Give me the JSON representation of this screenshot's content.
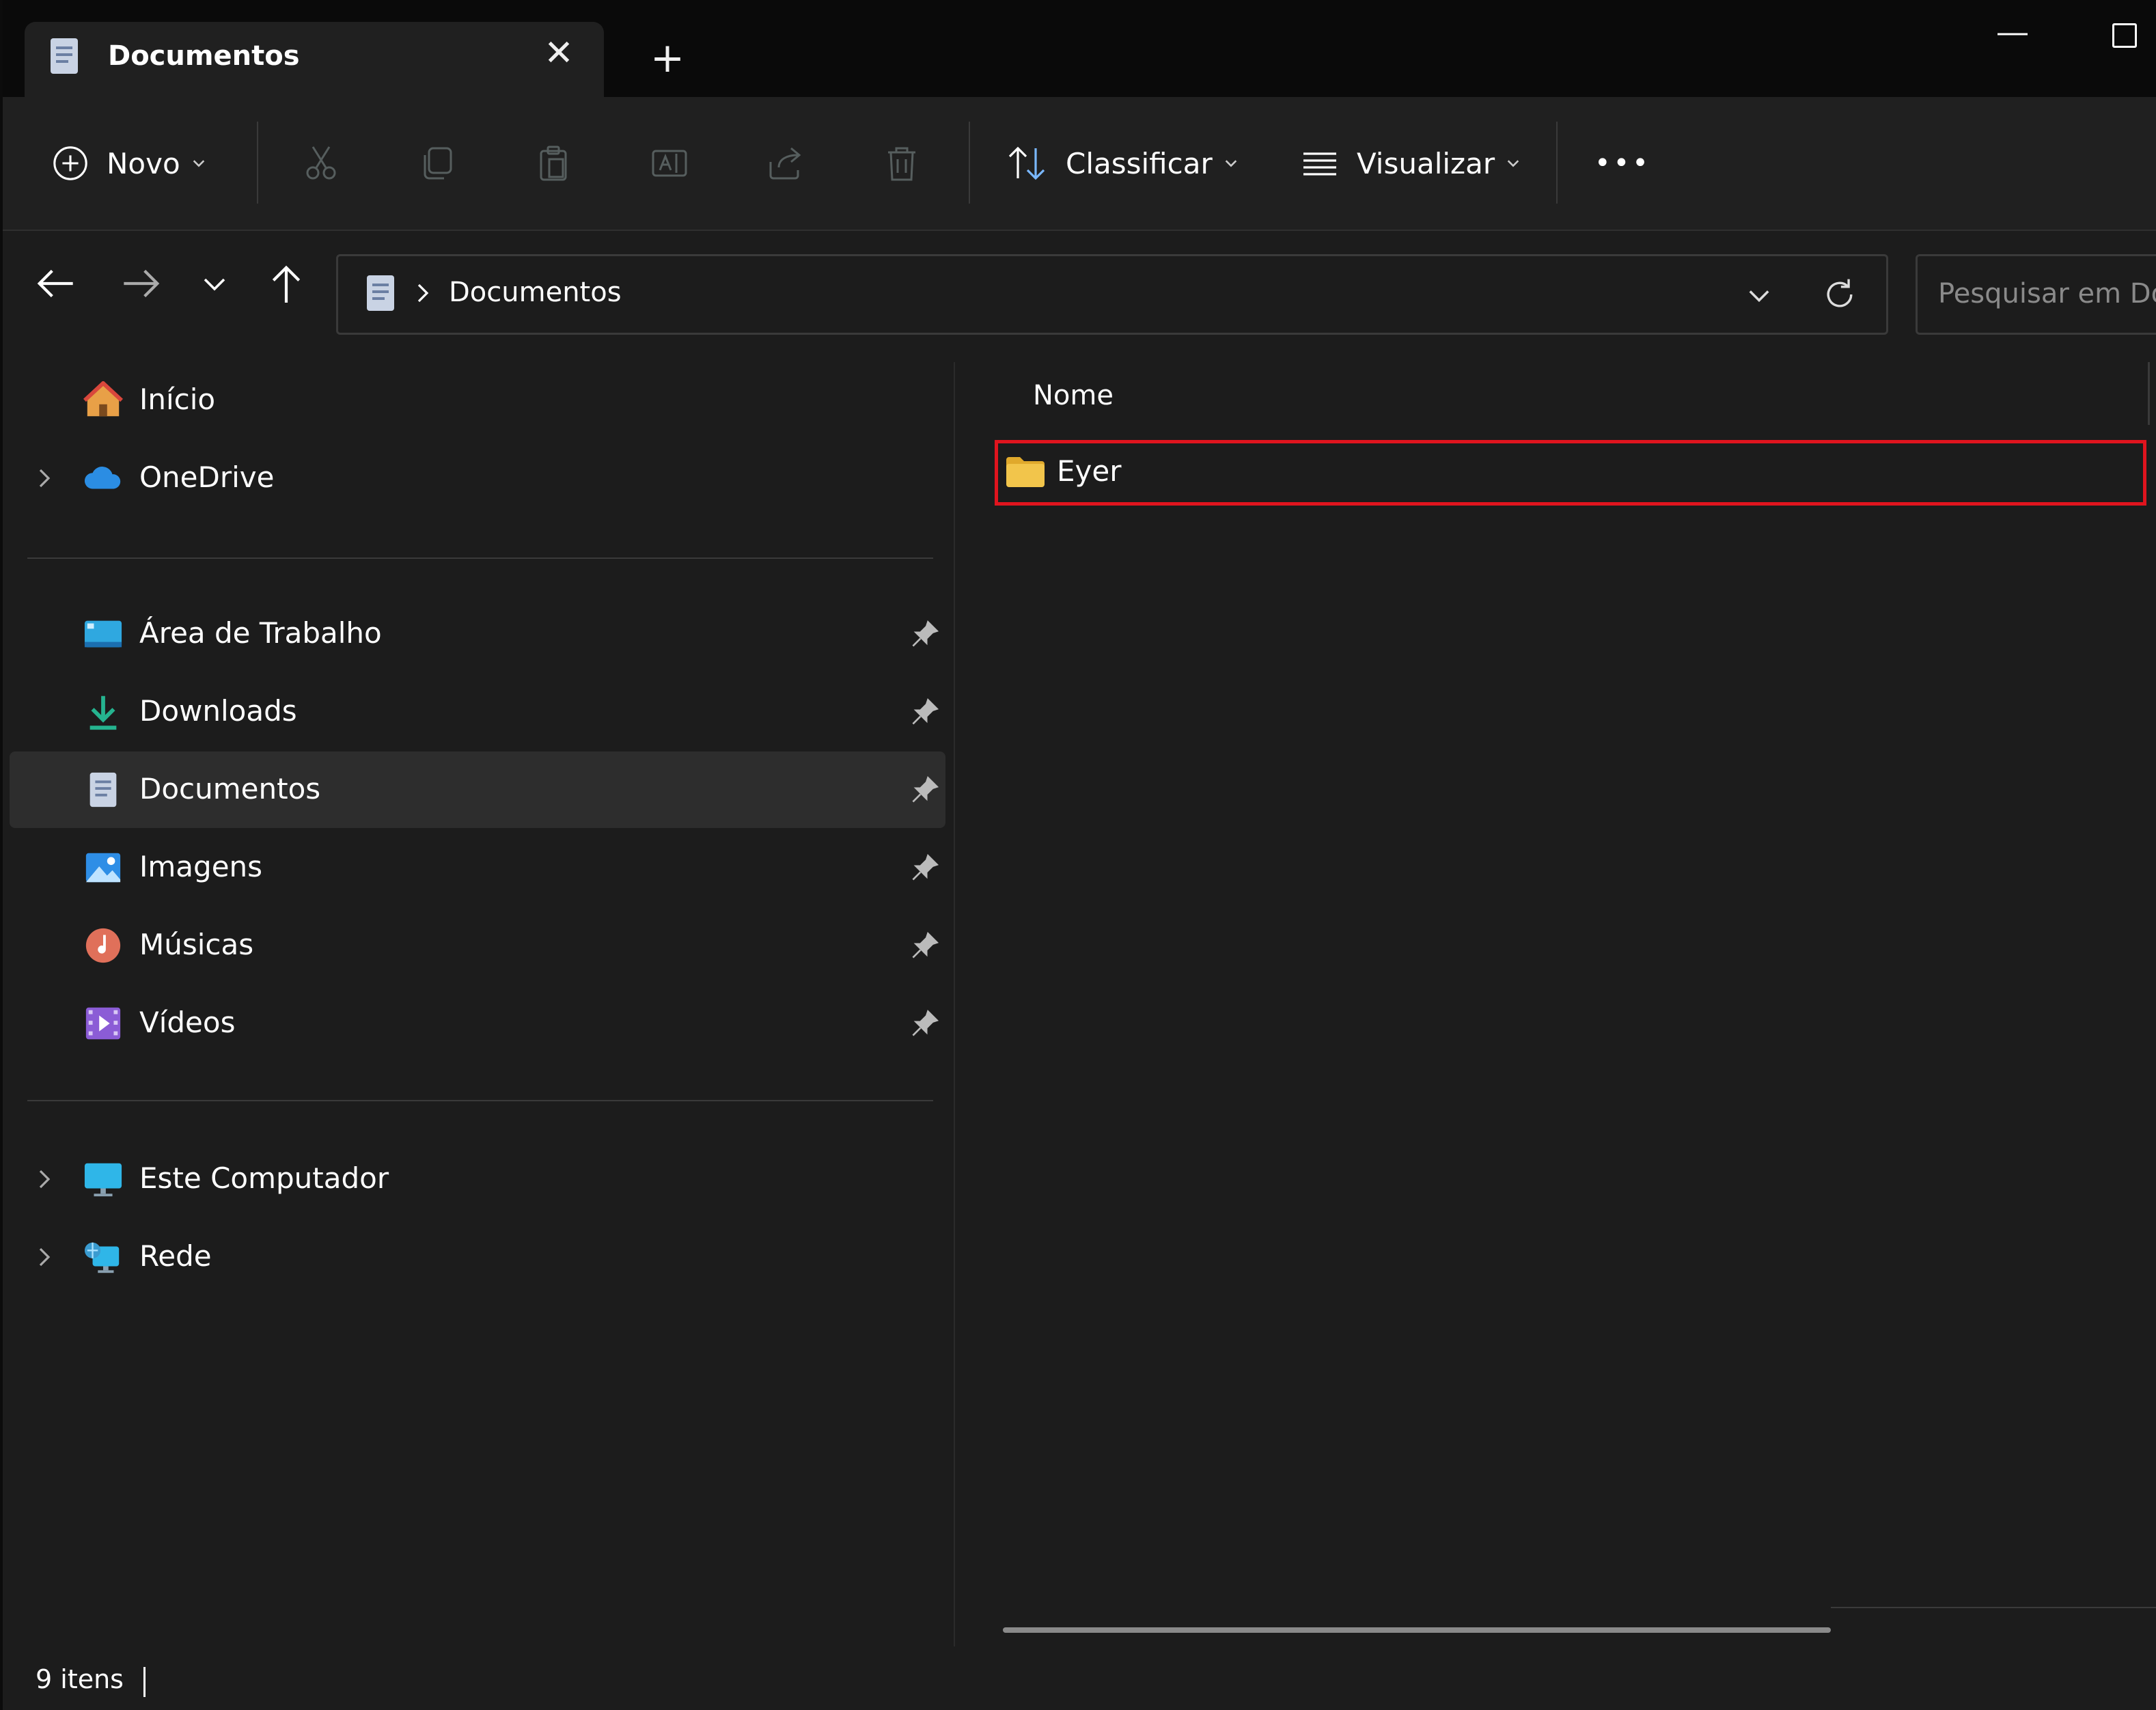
{
  "tab": {
    "title": "Documentos",
    "close_icon": "✕",
    "new_tab_icon": "+"
  },
  "toolbar": {
    "new_label": "Novo",
    "sort_label": "Classificar",
    "view_label": "Visualizar",
    "more_icon": "•••"
  },
  "address": {
    "path_label": "Documentos"
  },
  "search": {
    "placeholder": "Pesquisar em Documentos"
  },
  "sidebar": {
    "items": [
      {
        "label": "Início",
        "icon": "home-icon"
      },
      {
        "label": "OneDrive",
        "icon": "cloud-icon"
      },
      {
        "label": "Área de Trabalho",
        "icon": "desktop-icon"
      },
      {
        "label": "Downloads",
        "icon": "download-icon"
      },
      {
        "label": "Documentos",
        "icon": "documents-icon"
      },
      {
        "label": "Imagens",
        "icon": "pictures-icon"
      },
      {
        "label": "Músicas",
        "icon": "music-icon"
      },
      {
        "label": "Vídeos",
        "icon": "videos-icon"
      },
      {
        "label": "Este Computador",
        "icon": "computer-icon"
      },
      {
        "label": "Rede",
        "icon": "network-icon"
      }
    ]
  },
  "main": {
    "column_header": "Nome",
    "files": [
      {
        "name": "Eyer",
        "type": "folder"
      }
    ]
  },
  "status": {
    "item_count": "9 itens"
  },
  "colors": {
    "background": "#1c1c1c",
    "selected_item": "#2d2d2d",
    "highlight_box": "#e0141e",
    "folder_yellow": "#f2c54b"
  }
}
